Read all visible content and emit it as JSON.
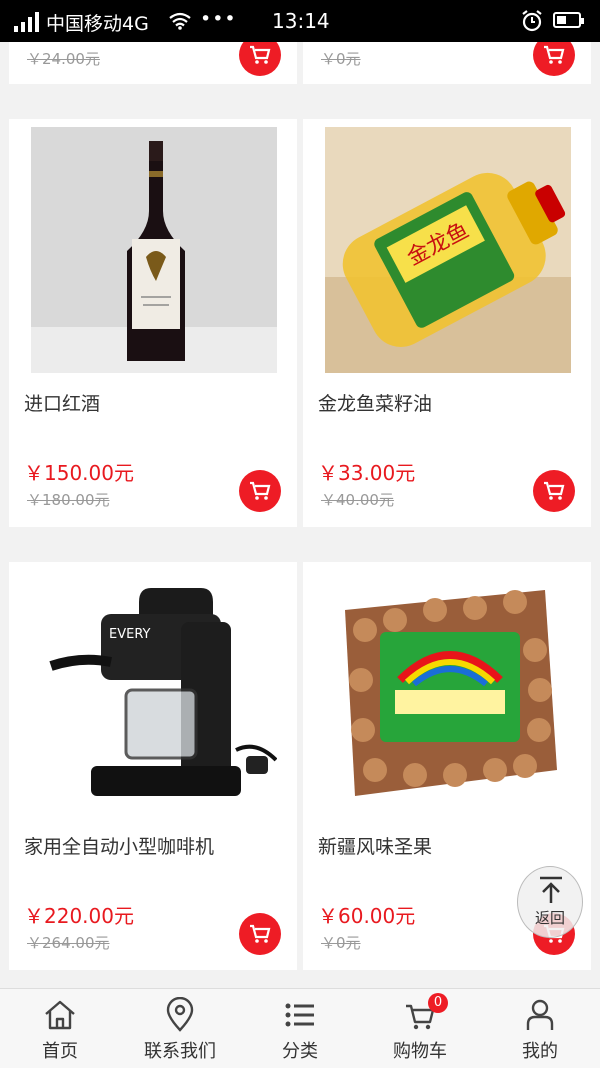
{
  "status_bar": {
    "carrier": "中国移动4G",
    "time": "13:14",
    "dots": "•••"
  },
  "partial_top": [
    {
      "old_price": "￥24.00元"
    },
    {
      "old_price": "￥0元"
    }
  ],
  "products": [
    {
      "name": "进口红酒",
      "price": "￥150.00元",
      "old_price": "￥180.00元",
      "image": "red-wine-bottle"
    },
    {
      "name": "金龙鱼菜籽油",
      "price": "￥33.00元",
      "old_price": "￥40.00元",
      "image": "rapeseed-oil-bottle"
    },
    {
      "name": "家用全自动小型咖啡机",
      "price": "￥220.00元",
      "old_price": "￥264.00元",
      "image": "coffee-machine"
    },
    {
      "name": "新疆风味圣果",
      "price": "￥60.00元",
      "old_price": "￥0元",
      "image": "nuts-package"
    }
  ],
  "back_to_top": {
    "label": "返回"
  },
  "tabbar": {
    "items": [
      {
        "label": "首页",
        "icon": "home-icon"
      },
      {
        "label": "联系我们",
        "icon": "location-pin-icon"
      },
      {
        "label": "分类",
        "icon": "list-icon"
      },
      {
        "label": "购物车",
        "icon": "cart-icon"
      },
      {
        "label": "我的",
        "icon": "user-icon"
      }
    ],
    "cart_badge": "0"
  },
  "colors": {
    "accent": "#ee1c25",
    "price": "#e8191f",
    "background": "#f2f2f2"
  }
}
